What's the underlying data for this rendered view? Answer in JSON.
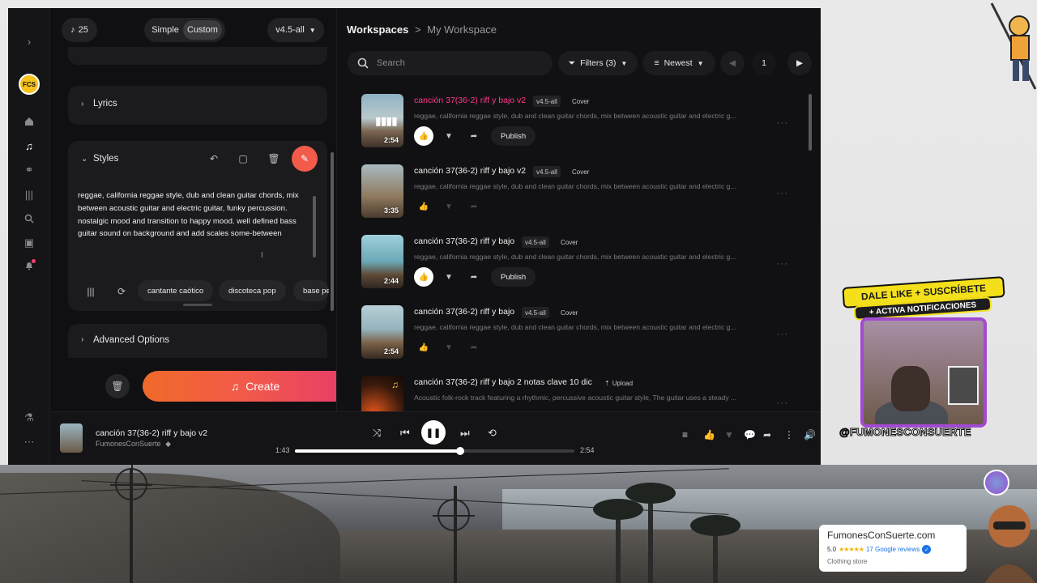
{
  "top_left": {
    "credits": "25",
    "mode_simple": "Simple",
    "mode_custom": "Custom",
    "model": "v4.5-all"
  },
  "left_panel": {
    "lyrics_label": "Lyrics",
    "styles_label": "Styles",
    "styles_text": "reggae, california reggae style, dub and clean guitar chords, mix between acoustic guitar and electric guitar, funky percussion. nostalgic mood and transition to happy mood. well defined bass guitar sound on background and add scales some-between",
    "tags": [
      "cantante caótico",
      "discoteca pop",
      "base pe"
    ],
    "advanced_label": "Advanced Options",
    "create_label": "Create"
  },
  "workspace": {
    "crumb_root": "Workspaces",
    "crumb_sep": ">",
    "crumb_current": "My Workspace",
    "search_placeholder": "Search",
    "filters_label": "Filters (3)",
    "sort_label": "Newest",
    "page": "1"
  },
  "songs": [
    {
      "title": "canción 37(36-2) riff y bajo v2",
      "version": "v4.5-all",
      "kind": "Cover",
      "desc": "reggae, california reggae style, dub and clean guitar chords, mix between acoustic guitar and electric g...",
      "duration": "2:54",
      "active": true,
      "publish": "Publish"
    },
    {
      "title": "canción 37(36-2) riff y bajo v2",
      "version": "v4.5-all",
      "kind": "Cover",
      "desc": "reggae, california reggae style, dub and clean guitar chords, mix between acoustic guitar and electric g...",
      "duration": "3:35",
      "active": false
    },
    {
      "title": "canción 37(36-2) riff y bajo",
      "version": "v4.5-all",
      "kind": "Cover",
      "desc": "reggae, california reggae style, dub and clean guitar chords, mix between acoustic guitar and electric g...",
      "duration": "2:44",
      "active": false,
      "publish": "Publish"
    },
    {
      "title": "canción 37(36-2) riff y bajo",
      "version": "v4.5-all",
      "kind": "Cover",
      "desc": "reggae, california reggae style, dub and clean guitar chords, mix between acoustic guitar and electric g...",
      "duration": "2:54",
      "active": false
    },
    {
      "title": "canción 37(36-2) riff y bajo 2 notas clave 10 dic",
      "version": "",
      "kind": "Upload",
      "desc": "Acoustic folk-rock track featuring a rhythmic, percussive acoustic guitar style, The guitar uses a steady ...",
      "duration": "",
      "active": false
    }
  ],
  "player": {
    "title": "canción 37(36-2) riff y bajo v2",
    "artist": "FumonesConSuerte",
    "elapsed": "1:43",
    "total": "2:54",
    "progress": 0.59
  },
  "overlay": {
    "banner1": "DALE LIKE + SUSCRÍBETE",
    "banner2": "+ ACTIVA NOTIFICACIONES",
    "handle": "@FUMONESCONSUERTE",
    "store_name": "FumonesConSuerte.com",
    "store_score": "5.0",
    "store_stars": "★★★★★",
    "store_reviews": "17 Google reviews",
    "store_type": "Clothing store",
    "logo_text": "FCS"
  },
  "colors": {
    "accent_pink": "#ff3a8c",
    "create_start": "#f06a2a",
    "create_end": "#e6376f"
  }
}
